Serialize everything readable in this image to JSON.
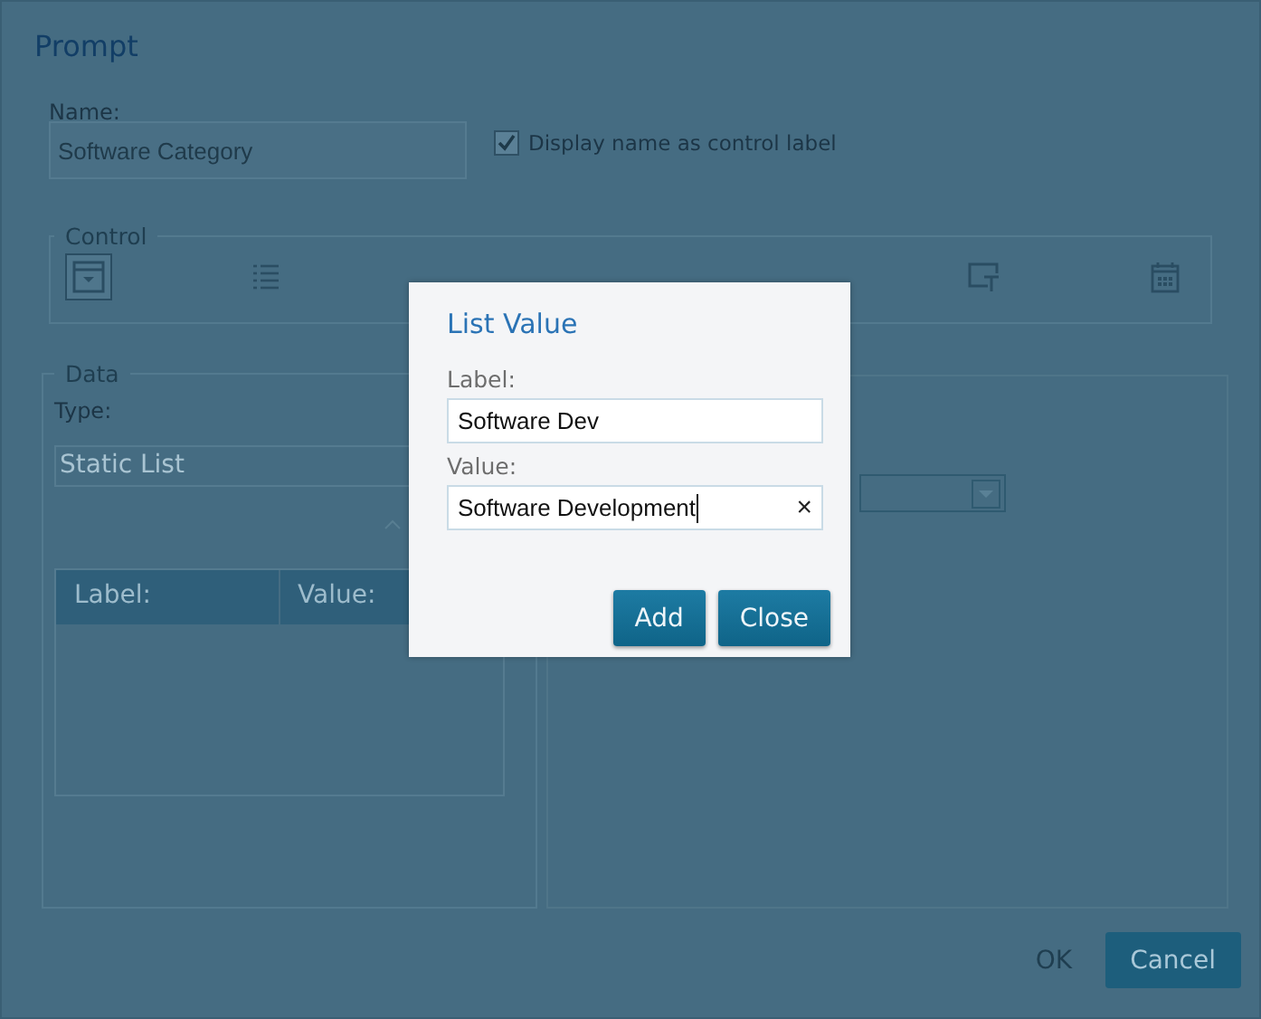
{
  "dialog": {
    "title": "Prompt",
    "name_label": "Name:",
    "name_value": "Software Category",
    "display_name_checkbox": {
      "label": "Display name as control label",
      "checked": true
    },
    "control_section": {
      "title": "Control",
      "controls": [
        {
          "kind": "dropdown",
          "selected": true
        },
        {
          "kind": "list",
          "selected": false
        },
        {
          "kind": "textbox",
          "selected": false
        },
        {
          "kind": "date",
          "selected": false
        }
      ]
    },
    "data_section": {
      "title": "Data",
      "type_label": "Type:",
      "type_value": "Static List",
      "table_columns": [
        "Label:",
        "Value:"
      ]
    },
    "buttons": [
      {
        "label": "OK",
        "disabled": true
      },
      {
        "label": "Cancel",
        "disabled": false
      }
    ]
  },
  "modal": {
    "title": "List Value",
    "fields": [
      {
        "label": "Label:",
        "value": "Software Dev"
      },
      {
        "label": "Value:",
        "value": "Software Development",
        "clear": "×"
      }
    ],
    "buttons": [
      "Add",
      "Close"
    ]
  }
}
